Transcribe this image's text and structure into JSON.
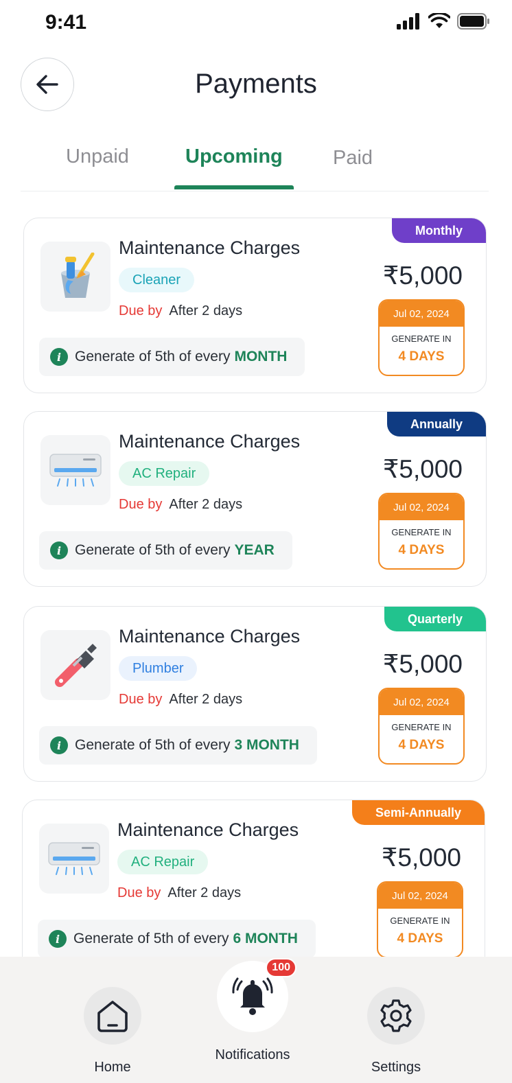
{
  "status_bar": {
    "time": "9:41"
  },
  "header": {
    "title": "Payments"
  },
  "tabs": [
    {
      "label": "Unpaid",
      "active": false
    },
    {
      "label": "Upcoming",
      "active": true
    },
    {
      "label": "Paid",
      "active": false
    }
  ],
  "cards": [
    {
      "frequency": "Monthly",
      "frequency_color": "#6f3fc9",
      "title": "Maintenance Charges",
      "category": "Cleaner",
      "category_color": "#1aa3b6",
      "category_bg": "#e8f8fb",
      "icon": "cleaning-bucket-icon",
      "due_label": "Due by",
      "due_value": "After 2 days",
      "generate_text": "Generate of 5th of every",
      "generate_period": "MONTH",
      "price": "₹5,000",
      "date": "Jul 02, 2024",
      "generate_in_label": "GENERATE IN",
      "generate_in_value": "4 DAYS"
    },
    {
      "frequency": "Annually",
      "frequency_color": "#0f3b82",
      "title": "Maintenance Charges",
      "category": "AC Repair",
      "category_color": "#21b07e",
      "category_bg": "#e6f8f0",
      "icon": "air-conditioner-icon",
      "due_label": "Due by",
      "due_value": "After 2 days",
      "generate_text": "Generate of 5th of every",
      "generate_period": "YEAR",
      "price": "₹5,000",
      "date": "Jul 02, 2024",
      "generate_in_label": "GENERATE IN",
      "generate_in_value": "4 DAYS"
    },
    {
      "frequency": "Quarterly",
      "frequency_color": "#22c38e",
      "title": "Maintenance Charges",
      "category": "Plumber",
      "category_color": "#2f7fe0",
      "category_bg": "#eaf2fd",
      "icon": "wrench-icon",
      "due_label": "Due by",
      "due_value": "After 2 days",
      "generate_text": "Generate of 5th of every",
      "generate_period": "3 MONTH",
      "price": "₹5,000",
      "date": "Jul 02, 2024",
      "generate_in_label": "GENERATE IN",
      "generate_in_value": "4 DAYS"
    },
    {
      "frequency": "Semi-Annually",
      "frequency_color": "#f47f1a",
      "title": "Maintenance Charges",
      "category": "AC Repair",
      "category_color": "#21b07e",
      "category_bg": "#e6f8f0",
      "icon": "air-conditioner-icon",
      "due_label": "Due by",
      "due_value": "After 2 days",
      "generate_text": "Generate of 5th of every",
      "generate_period": "6 MONTH",
      "price": "₹5,000",
      "date": "Jul 02, 2024",
      "generate_in_label": "GENERATE IN",
      "generate_in_value": "4 DAYS"
    }
  ],
  "bottom_nav": {
    "home_label": "Home",
    "notifications_label": "Notifications",
    "notifications_badge": "100",
    "settings_label": "Settings"
  }
}
